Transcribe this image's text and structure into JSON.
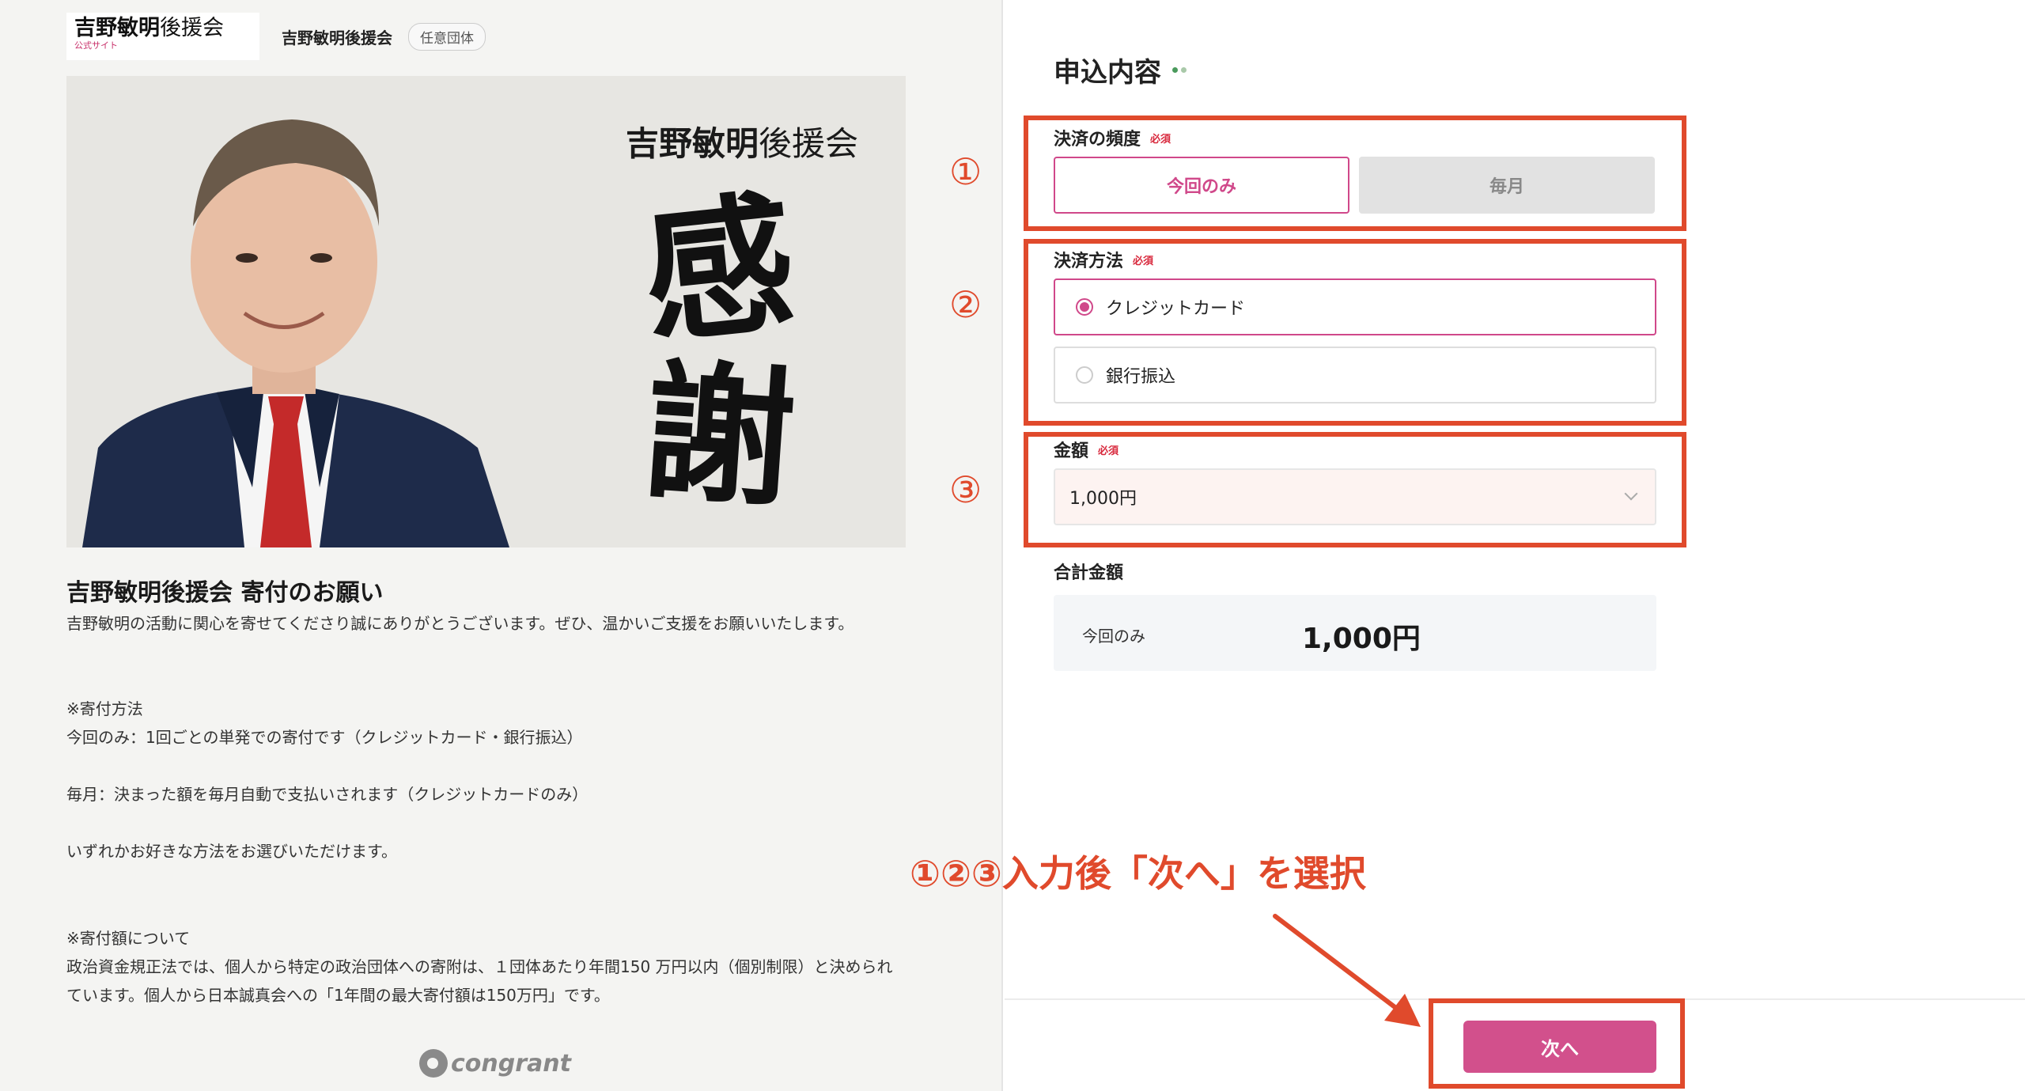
{
  "header": {
    "logo_main": "吉野敏明",
    "logo_main_light": "後援会",
    "logo_sub": "公式サイト",
    "org_name": "吉野敏明後援会",
    "org_badge": "任意団体"
  },
  "hero": {
    "title_bold": "吉野敏明",
    "title_light": "後援会",
    "kanji_1": "感",
    "kanji_2": "謝"
  },
  "description": {
    "title": "吉野敏明後援会 寄付のお願い",
    "intro": "吉野敏明の活動に関心を寄せてくださり誠にありがとうございます。ぜひ、温かいご支援をお願いいたします。",
    "method_heading": "※寄付方法",
    "method_once": "今回のみ：1回ごとの単発での寄付です（クレジットカード・銀行振込）",
    "method_monthly": "毎月：決まった額を毎月自動で支払いされます（クレジットカードのみ）",
    "method_choose": "いずれかお好きな方法をお選びいただけます。",
    "limit_heading": "※寄付額について",
    "limit_text": "政治資金規正法では、個人から特定の政治団体への寄附は、１団体あたり年間150 万円以内（個別制限）と決められています。個人から日本誠真会への「1年間の最大寄付額は150万円」です。",
    "powered_by": "congrant"
  },
  "form": {
    "title": "申込内容",
    "frequency": {
      "label": "決済の頻度",
      "required": "必須",
      "options": [
        "今回のみ",
        "毎月"
      ],
      "selected": "今回のみ"
    },
    "payment_method": {
      "label": "決済方法",
      "required": "必須",
      "options": [
        "クレジットカード",
        "銀行振込"
      ],
      "selected": "クレジットカード"
    },
    "amount": {
      "label": "金額",
      "required": "必須",
      "value": "1,000円"
    },
    "total": {
      "label": "合計金額",
      "kind": "今回のみ",
      "amount": "1,000円"
    },
    "next_label": "次へ"
  },
  "annotations": {
    "num_1": "①",
    "num_2": "②",
    "num_3": "③",
    "instruction": "①②③入力後「次へ」を選択",
    "color": "#e04a2c"
  },
  "colors": {
    "accent": "#d0488a",
    "button": "#d2508c",
    "select_bg": "#fdf3f1",
    "total_bg": "#f4f6f8",
    "left_bg": "#f4f4f2"
  }
}
